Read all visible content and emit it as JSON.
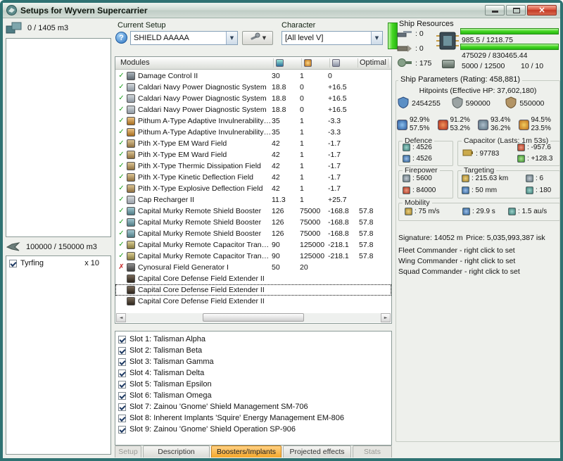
{
  "window": {
    "title": "Setups for Wyvern Supercarrier"
  },
  "icons": {
    "check": "✓",
    "cross": "✗",
    "dropdown": "▼",
    "left": "◄",
    "right": "►",
    "help": "?",
    "close": "×"
  },
  "left": {
    "cargo_label": "0 / 1405 m3",
    "drone_label": "100000 / 150000 m3",
    "drones": [
      {
        "name": "Tyrfing",
        "qty": "x 10",
        "checked": true
      }
    ]
  },
  "setup": {
    "label": "Current Setup",
    "value": "SHIELD AAAAA"
  },
  "character": {
    "label": "Character",
    "value": "[All level V]"
  },
  "resources": {
    "title": "Ship Resources",
    "slots": [
      {
        "icon": "turret-hardpoints-icon",
        "value": ": 0"
      },
      {
        "icon": "launcher-hardpoints-icon",
        "value": ": 0"
      },
      {
        "icon": "calibration-icon",
        "value": ": 175"
      }
    ],
    "cpu": {
      "text": "985.5 / 1218.75",
      "pct": 100
    },
    "powergrid": {
      "text": "475029 / 830465.44",
      "pct": 100
    },
    "dronebay": "5000 / 12500",
    "drones_active": "10 / 10"
  },
  "modules": {
    "col_name": "Modules",
    "col_optimal": "Optimal",
    "rows": [
      {
        "state": "on",
        "icon": "damage-control",
        "name": "Damage Control II",
        "cpu": "30",
        "pg": "1",
        "cap": "0",
        "opt": ""
      },
      {
        "state": "on",
        "icon": "power-diagnostic",
        "name": "Caldari Navy Power Diagnostic System",
        "cpu": "18.8",
        "pg": "0",
        "cap": "+16.5",
        "opt": ""
      },
      {
        "state": "on",
        "icon": "power-diagnostic",
        "name": "Caldari Navy Power Diagnostic System",
        "cpu": "18.8",
        "pg": "0",
        "cap": "+16.5",
        "opt": ""
      },
      {
        "state": "on",
        "icon": "power-diagnostic",
        "name": "Caldari Navy Power Diagnostic System",
        "cpu": "18.8",
        "pg": "0",
        "cap": "+16.5",
        "opt": ""
      },
      {
        "state": "on",
        "icon": "invulnerability-field",
        "name": "Pithum A-Type Adaptive Invulnerability Fi...",
        "cpu": "35",
        "pg": "1",
        "cap": "-3.3",
        "opt": ""
      },
      {
        "state": "on",
        "icon": "invulnerability-field",
        "name": "Pithum A-Type Adaptive Invulnerability Fi...",
        "cpu": "35",
        "pg": "1",
        "cap": "-3.3",
        "opt": ""
      },
      {
        "state": "on",
        "icon": "ward-field",
        "name": "Pith X-Type EM Ward Field",
        "cpu": "42",
        "pg": "1",
        "cap": "-1.7",
        "opt": ""
      },
      {
        "state": "on",
        "icon": "ward-field",
        "name": "Pith X-Type EM Ward Field",
        "cpu": "42",
        "pg": "1",
        "cap": "-1.7",
        "opt": ""
      },
      {
        "state": "on",
        "icon": "ward-field",
        "name": "Pith X-Type Thermic Dissipation Field",
        "cpu": "42",
        "pg": "1",
        "cap": "-1.7",
        "opt": ""
      },
      {
        "state": "on",
        "icon": "ward-field",
        "name": "Pith X-Type Kinetic Deflection Field",
        "cpu": "42",
        "pg": "1",
        "cap": "-1.7",
        "opt": ""
      },
      {
        "state": "on",
        "icon": "ward-field",
        "name": "Pith X-Type Explosive Deflection Field",
        "cpu": "42",
        "pg": "1",
        "cap": "-1.7",
        "opt": ""
      },
      {
        "state": "on",
        "icon": "cap-recharger",
        "name": "Cap Recharger II",
        "cpu": "11.3",
        "pg": "1",
        "cap": "+25.7",
        "opt": ""
      },
      {
        "state": "on",
        "icon": "remote-shield-booster",
        "name": "Capital Murky Remote Shield Booster",
        "cpu": "126",
        "pg": "75000",
        "cap": "-168.8",
        "opt": "57.8"
      },
      {
        "state": "on",
        "icon": "remote-shield-booster",
        "name": "Capital Murky Remote Shield Booster",
        "cpu": "126",
        "pg": "75000",
        "cap": "-168.8",
        "opt": "57.8"
      },
      {
        "state": "on",
        "icon": "remote-shield-booster",
        "name": "Capital Murky Remote Shield Booster",
        "cpu": "126",
        "pg": "75000",
        "cap": "-168.8",
        "opt": "57.8"
      },
      {
        "state": "on",
        "icon": "remote-cap-transmitter",
        "name": "Capital Murky Remote Capacitor Transmit...",
        "cpu": "90",
        "pg": "125000",
        "cap": "-218.1",
        "opt": "57.8"
      },
      {
        "state": "on",
        "icon": "remote-cap-transmitter",
        "name": "Capital Murky Remote Capacitor Transmit...",
        "cpu": "90",
        "pg": "125000",
        "cap": "-218.1",
        "opt": "57.8"
      },
      {
        "state": "off",
        "icon": "cyno-generator",
        "name": "Cynosural Field Generator I",
        "cpu": "50",
        "pg": "20",
        "cap": "",
        "opt": ""
      },
      {
        "state": "rig",
        "icon": "rig",
        "name": "Capital Core Defense Field Extender II",
        "cpu": "",
        "pg": "",
        "cap": "",
        "opt": ""
      },
      {
        "state": "rig",
        "icon": "rig",
        "name": "Capital Core Defense Field Extender II",
        "cpu": "",
        "pg": "",
        "cap": "",
        "opt": "",
        "selected": true
      },
      {
        "state": "rig",
        "icon": "rig",
        "name": "Capital Core Defense Field Extender II",
        "cpu": "",
        "pg": "",
        "cap": "",
        "opt": ""
      }
    ]
  },
  "implants": [
    "Slot 1: Talisman Alpha",
    "Slot 2: Talisman Beta",
    "Slot 3: Talisman Gamma",
    "Slot 4: Talisman Delta",
    "Slot 5: Talisman Epsilon",
    "Slot 6: Talisman Omega",
    "Slot 7: Zainou 'Gnome' Shield Management SM-706",
    "Slot 8: Inherent Implants 'Squire' Energy Management EM-806",
    "Slot 9: Zainou 'Gnome' Shield Operation SP-906"
  ],
  "tabs": [
    {
      "label": "Setup",
      "state": "disabled"
    },
    {
      "label": "Description",
      "state": "normal"
    },
    {
      "label": "Boosters/Implants",
      "state": "active"
    },
    {
      "label": "Projected effects",
      "state": "normal"
    },
    {
      "label": "Stats",
      "state": "disabled"
    }
  ],
  "params": {
    "title": "Ship Parameters (Rating: 458,881)",
    "hitpoints_title": "Hitpoints (Effective HP: 37,602,180)",
    "shield_hp": "2454255",
    "armor_hp": "590000",
    "hull_hp": "550000",
    "resists": [
      {
        "type": "em",
        "shield": "92.9%",
        "armor": "57.5%"
      },
      {
        "type": "thermal",
        "shield": "91.2%",
        "armor": "53.2%"
      },
      {
        "type": "kinetic",
        "shield": "93.4%",
        "armor": "36.2%"
      },
      {
        "type": "explosive",
        "shield": "94.5%",
        "armor": "23.5%"
      }
    ],
    "defence": {
      "title": "Defence",
      "shield_recharge": ": 4526",
      "shield_boost": ": 4526"
    },
    "capacitor": {
      "title": "Capacitor (Lasts: 1m 53s)",
      "amount": ": 97783",
      "drain": ": -957.6",
      "recharge": ": +128.3"
    },
    "firepower": {
      "title": "Firepower",
      "volley": ": 5600",
      "dps": ": 84000"
    },
    "targeting": {
      "title": "Targeting",
      "range": ": 215.63 km",
      "max_targets": ": 6",
      "scan_resolution": ": 50 mm",
      "sensor_strength": ": 180"
    },
    "mobility": {
      "title": "Mobility",
      "speed": ": 75 m/s",
      "align_time": ": 29.9 s",
      "warp_speed": ": 1.5 au/s"
    },
    "signature": "Signature: 14052 m",
    "price": "Price: 5,035,993,387 isk",
    "commanders": [
      "Fleet Commander - right click to set",
      "Wing Commander - right click to set",
      "Squad Commander - right click to set"
    ]
  }
}
